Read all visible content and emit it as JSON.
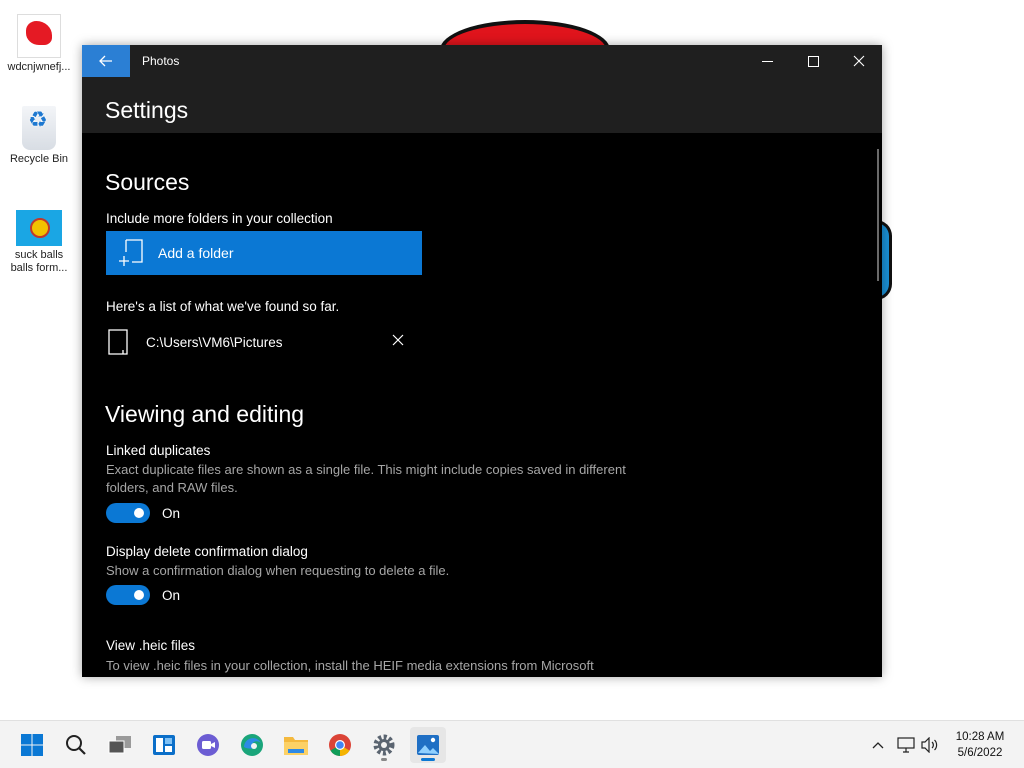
{
  "desktop": {
    "icons": [
      {
        "label": "wdcnjwnefj..."
      },
      {
        "label": "Recycle Bin"
      },
      {
        "label": "suck balls balls form..."
      }
    ]
  },
  "window": {
    "app_title": "Photos",
    "page_title": "Settings"
  },
  "sources": {
    "heading": "Sources",
    "include_label": "Include more folders in your collection",
    "add_folder_label": "Add a folder",
    "found_label": "Here's a list of what we've found so far.",
    "folders": [
      {
        "path": "C:\\Users\\VM6\\Pictures"
      }
    ]
  },
  "viewing": {
    "heading": "Viewing and editing",
    "linked_duplicates": {
      "title": "Linked duplicates",
      "description": "Exact duplicate files are shown as a single file. This might include copies saved in different folders, and RAW files.",
      "state": "On"
    },
    "delete_confirm": {
      "title": "Display delete confirmation dialog",
      "description": "Show a confirmation dialog when requesting to delete a file.",
      "state": "On"
    },
    "heic": {
      "title": "View .heic files",
      "description": "To view .heic files in your collection, install the HEIF media extensions from Microsoft"
    }
  },
  "taskbar": {
    "clock_time": "10:28 AM",
    "clock_date": "5/6/2022"
  },
  "colors": {
    "accent": "#0b78d4",
    "window_bg": "#000000",
    "titlebar_bg": "#1f1f1f",
    "taskbar_bg": "#f3f3f3"
  }
}
